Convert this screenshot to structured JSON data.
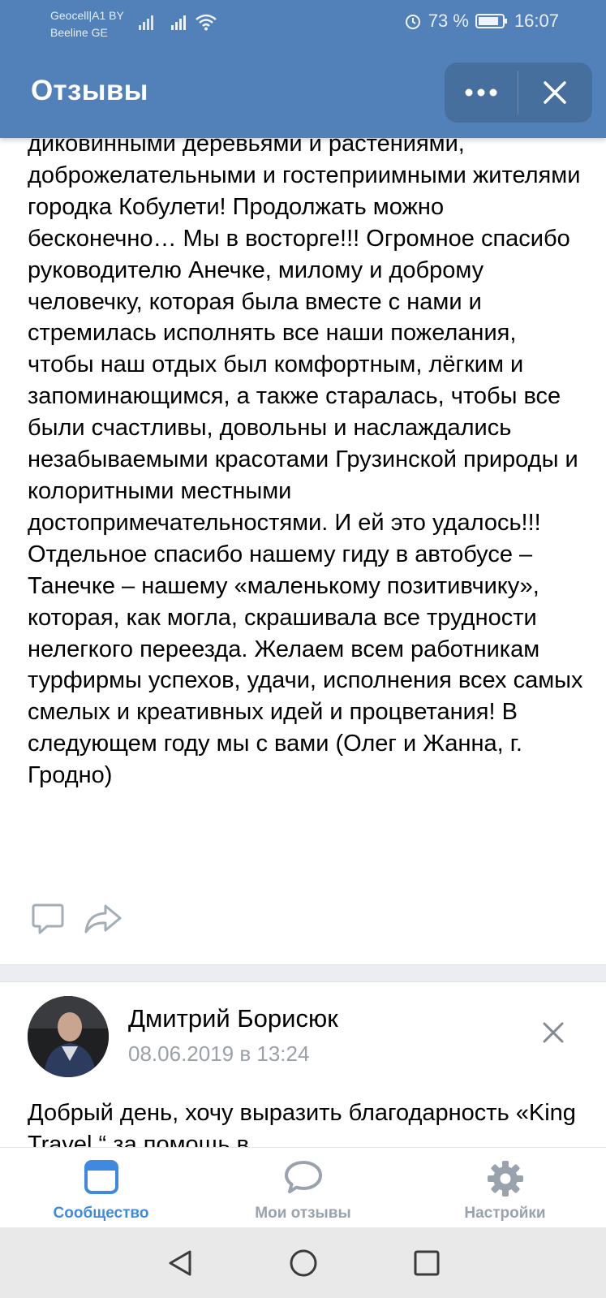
{
  "status_bar": {
    "carrier_line1": "Geocell|A1 BY",
    "carrier_line2": "Beeline GE",
    "battery": "73 %",
    "time": "16:07"
  },
  "header": {
    "title": "Отзывы"
  },
  "post1": {
    "text": "диковинными деревьями и растениями, доброжелательными и гостеприимными жителями городка Кобулети! Продолжать можно бесконечно… Мы в восторге!!! Огромное спасибо руководителю Анечке, милому и доброму человечку, которая была вместе с нами и стремилась исполнять все наши пожелания, чтобы наш отдых был комфортным, лёгким и запоминающимся, а также старалась, чтобы все были счастливы, довольны и наслаждались незабываемыми красотами Грузинской природы и колоритными местными достопримечательностями. И ей это удалось!!! Отдельное спасибо нашему гиду в автобусе – Танечке – нашему «маленькому позитивчику», которая, как могла, скрашивала все трудности нелегкого переезда. Желаем всем работникам турфирмы успехов, удачи, исполнения всех самых смелых и креативных идей и процветания! В следующем году мы с вами (Олег и Жанна, г. Гродно)",
    "actions": [
      "comment-icon",
      "share-icon"
    ]
  },
  "post2": {
    "author": "Дмитрий Борисюк",
    "date": "08.06.2019 в 13:24",
    "text": "Добрый день, хочу выразить благодарность «King Travel “ за помощь в"
  },
  "tabs": [
    {
      "label": "Сообщество",
      "icon": "community-icon",
      "active": true
    },
    {
      "label": "Мои отзывы",
      "icon": "chat-bubble-icon",
      "active": false
    },
    {
      "label": "Настройки",
      "icon": "gear-icon",
      "active": false
    }
  ],
  "colors": {
    "header": "#5181b8",
    "accent": "#3f8ae0",
    "inactive": "#99a2ad",
    "date": "#9aa1a8"
  }
}
